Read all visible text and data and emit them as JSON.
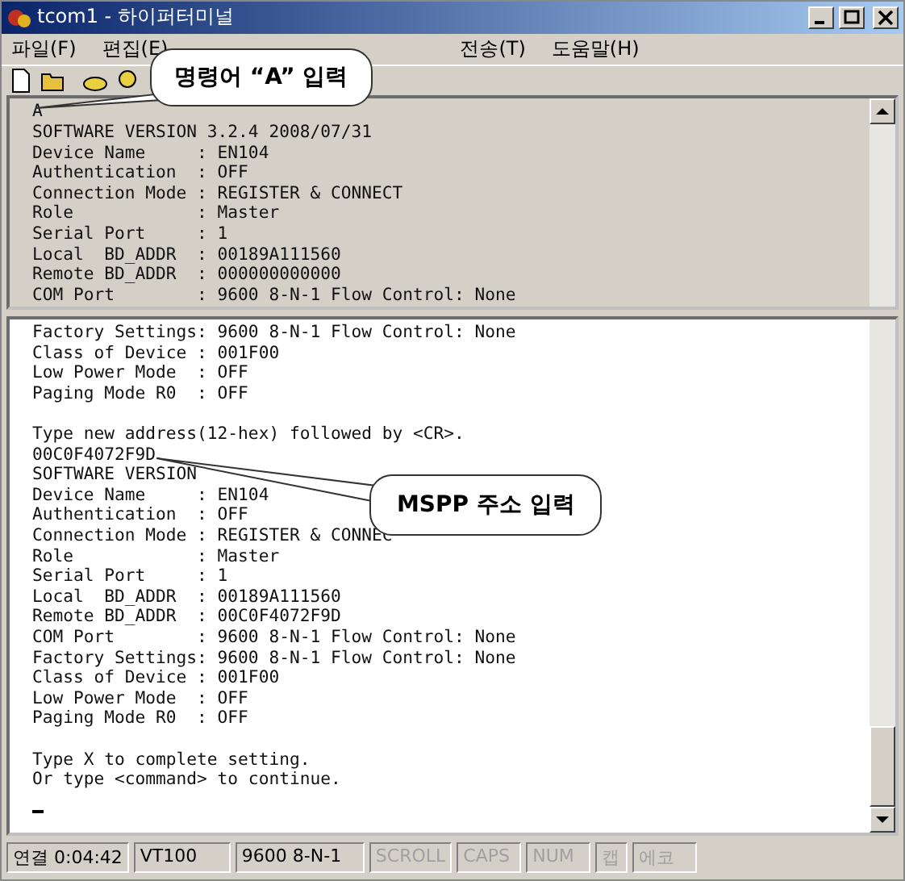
{
  "window": {
    "title": "tcom1 - 하이퍼터미널"
  },
  "menu": [
    {
      "label": "파일(F)"
    },
    {
      "label": "편집(E)"
    },
    {
      "label": "전송(T)"
    },
    {
      "label": "도움말(H)"
    }
  ],
  "callouts": [
    {
      "text": "명령어 “A” 입력"
    },
    {
      "text": "MSPP 주소 입력"
    }
  ],
  "top_terminal": {
    "blocks": [
      [
        "A",
        "SOFTWARE VERSION 3.2.4 2008/07/31",
        "Device Name     : EN104",
        "Authentication  : OFF",
        "Connection Mode : REGISTER & CONNECT",
        "Role            : Master",
        "Serial Port     : 1",
        "Local  BD_ADDR  : 00189A111560",
        "Remote BD_ADDR  : 000000000000",
        "COM Port        : 9600 8-N-1 Flow Control: None"
      ]
    ]
  },
  "bottom_terminal": {
    "blocks": [
      [
        "Factory Settings: 9600 8-N-1 Flow Control: None",
        "Class of Device : 001F00",
        "Low Power Mode  : OFF",
        "Paging Mode R0  : OFF"
      ],
      [
        "Type new address(12-hex) followed by <CR>.",
        "00C0F4072F9D",
        "SOFTWARE VERSION",
        "Device Name     : EN104",
        "Authentication  : OFF",
        "Connection Mode : REGISTER & CONNEC",
        "Role            : Master",
        "Serial Port     : 1",
        "Local  BD_ADDR  : 00189A111560",
        "Remote BD_ADDR  : 00C0F4072F9D",
        "COM Port        : 9600 8-N-1 Flow Control: None",
        "Factory Settings: 9600 8-N-1 Flow Control: None",
        "Class of Device : 001F00",
        "Low Power Mode  : OFF",
        "Paging Mode R0  : OFF"
      ],
      [
        "Type X to complete setting.",
        "Or type <command> to continue."
      ]
    ]
  },
  "status_bar": [
    {
      "label": "연결 0:04:42",
      "disabled": false
    },
    {
      "label": "VT100",
      "disabled": false
    },
    {
      "label": "9600 8-N-1",
      "disabled": false
    },
    {
      "label": "SCROLL",
      "disabled": true
    },
    {
      "label": "CAPS",
      "disabled": true
    },
    {
      "label": "NUM",
      "disabled": true
    },
    {
      "label": "캡",
      "disabled": true
    },
    {
      "label": "에코",
      "disabled": true
    }
  ]
}
